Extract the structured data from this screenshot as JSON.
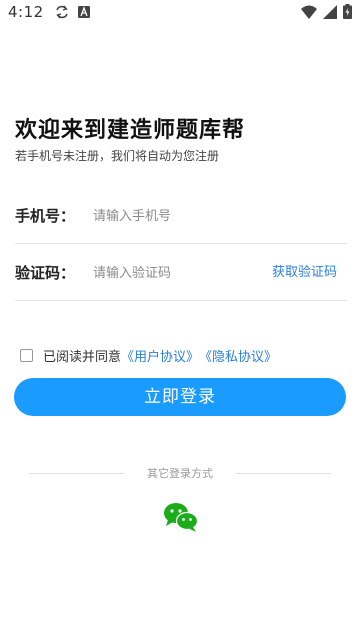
{
  "status_bar": {
    "time": "4:12",
    "icons": [
      "sync-icon",
      "font-icon",
      "wifi-icon",
      "signal-icon",
      "battery-icon"
    ]
  },
  "header": {
    "title": "欢迎来到建造师题库帮",
    "subtitle": "若手机号未注册，我们将自动为您注册"
  },
  "form": {
    "phone_label": "手机号：",
    "phone_placeholder": "请输入手机号",
    "phone_value": "",
    "code_label": "验证码：",
    "code_placeholder": "请输入验证码",
    "code_value": "",
    "get_code_label": "获取验证码"
  },
  "agreement": {
    "checked": false,
    "prefix": "已阅读并同意",
    "user_agreement": "《用户协议》",
    "privacy_agreement": "《隐私协议》"
  },
  "login_button": "立即登录",
  "other_login": {
    "label": "其它登录方式",
    "methods": [
      "wechat-icon"
    ]
  },
  "colors": {
    "accent": "#1a9bff",
    "link": "#2a7fdb",
    "wechat": "#1aad19"
  }
}
